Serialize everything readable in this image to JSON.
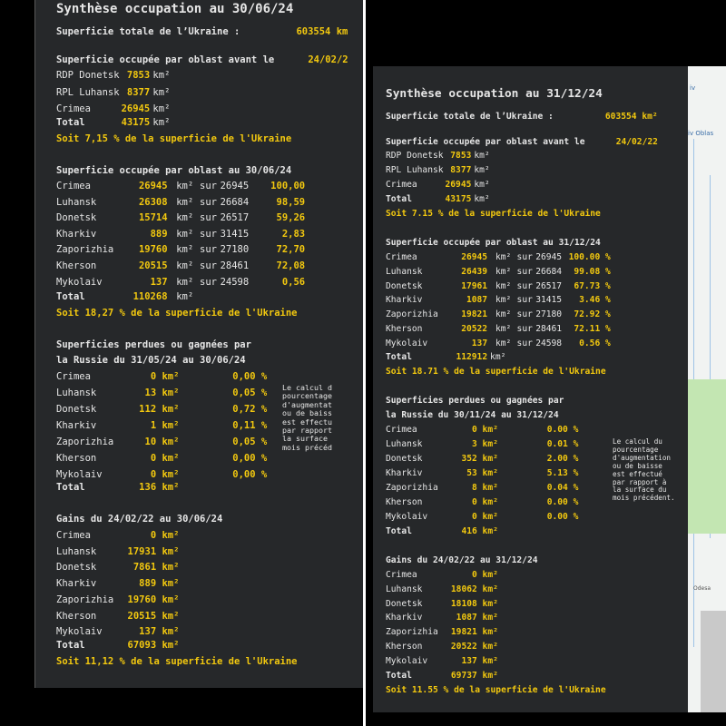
{
  "left": {
    "title": "Synthèse occupation au 30/06/24",
    "total_label": "Superficie totale de l’Ukraine :",
    "total_value": "603554 km",
    "before_head": "Superficie occupée par oblast avant le",
    "before_date": "24/02/2",
    "before_rows": [
      {
        "name": "RDP Donetsk",
        "value": "7853",
        "unit": "km²"
      },
      {
        "name": "RPL Luhansk",
        "value": "8377",
        "unit": "km²"
      },
      {
        "name": "Crimea",
        "value": "26945",
        "unit": "km²"
      }
    ],
    "before_total_label": "Total",
    "before_total_value": "43175",
    "before_total_unit": "km²",
    "before_share": "Soit 7,15 % de la superficie de l'Ukraine",
    "occ_head": "Superficie occupée par oblast au 30/06/24",
    "occ_rows": [
      {
        "name": "Crimea",
        "value": "26945",
        "unit": "km²",
        "sur": "sur",
        "total": "26945",
        "pct": "100,00"
      },
      {
        "name": "Luhansk",
        "value": "26308",
        "unit": "km²",
        "sur": "sur",
        "total": "26684",
        "pct": "98,59"
      },
      {
        "name": "Donetsk",
        "value": "15714",
        "unit": "km²",
        "sur": "sur",
        "total": "26517",
        "pct": "59,26"
      },
      {
        "name": "Kharkiv",
        "value": "889",
        "unit": "km²",
        "sur": "sur",
        "total": "31415",
        "pct": "2,83"
      },
      {
        "name": "Zaporizhia",
        "value": "19760",
        "unit": "km²",
        "sur": "sur",
        "total": "27180",
        "pct": "72,70"
      },
      {
        "name": "Kherson",
        "value": "20515",
        "unit": "km²",
        "sur": "sur",
        "total": "28461",
        "pct": "72,08"
      },
      {
        "name": "Mykolaiv",
        "value": "137",
        "unit": "km²",
        "sur": "sur",
        "total": "24598",
        "pct": "0,56"
      }
    ],
    "occ_total_label": "Total",
    "occ_total_value": "110268",
    "occ_total_unit": "km²",
    "occ_share": "Soit 18,27 % de la superficie de l'Ukraine",
    "change_head1": "Superficies perdues ou gagnées par",
    "change_head2": "la Russie du 31/05/24 au 30/06/24",
    "change_rows": [
      {
        "name": "Crimea",
        "value": "0 km²",
        "pct": "0,00 %"
      },
      {
        "name": "Luhansk",
        "value": "13 km²",
        "pct": "0,05 %"
      },
      {
        "name": "Donetsk",
        "value": "112 km²",
        "pct": "0,72 %"
      },
      {
        "name": "Kharkiv",
        "value": "1 km²",
        "pct": "0,11 %"
      },
      {
        "name": "Zaporizhia",
        "value": "10 km²",
        "pct": "0,05 %"
      },
      {
        "name": "Kherson",
        "value": "0 km²",
        "pct": "0,00 %"
      },
      {
        "name": "Mykolaiv",
        "value": "0 km²",
        "pct": "0,00 %"
      }
    ],
    "change_total_label": "Total",
    "change_total_value": "136 km²",
    "note_lines": [
      "Le calcul d",
      "pourcentage",
      "d'augmentat",
      "ou de baiss",
      "est effectu",
      "par rapport",
      "la surface",
      "mois précéd"
    ],
    "gains_head": "Gains du 24/02/22 au 30/06/24",
    "gains_rows": [
      {
        "name": "Crimea",
        "value": "0 km²"
      },
      {
        "name": "Luhansk",
        "value": "17931 km²"
      },
      {
        "name": "Donetsk",
        "value": "7861 km²"
      },
      {
        "name": "Kharkiv",
        "value": "889 km²"
      },
      {
        "name": "Zaporizhia",
        "value": "19760 km²"
      },
      {
        "name": "Kherson",
        "value": "20515 km²"
      },
      {
        "name": "Mykolaiv",
        "value": "137 km²"
      }
    ],
    "gains_total_label": "Total",
    "gains_total_value": "67093 km²",
    "gains_share": "Soit 11,12 % de la superficie de l'Ukraine"
  },
  "right": {
    "title": "Synthèse occupation au 31/12/24",
    "total_label": "Superficie totale de l’Ukraine :",
    "total_value": "603554 km²",
    "before_head": "Superficie occupée par oblast avant le",
    "before_date": "24/02/22",
    "before_rows": [
      {
        "name": "RDP Donetsk",
        "value": "7853",
        "unit": "km²"
      },
      {
        "name": "RPL Luhansk",
        "value": "8377",
        "unit": "km²"
      },
      {
        "name": "Crimea",
        "value": "26945",
        "unit": "km²"
      }
    ],
    "before_total_label": "Total",
    "before_total_value": "43175",
    "before_total_unit": "km²",
    "before_share": "Soit 7.15 % de la superficie de l'Ukraine",
    "occ_head": "Superficie occupée par oblast au 31/12/24",
    "occ_rows": [
      {
        "name": "Crimea",
        "value": "26945",
        "unit": "km²",
        "sur": "sur",
        "total": "26945",
        "pct": "100.00 %"
      },
      {
        "name": "Luhansk",
        "value": "26439",
        "unit": "km²",
        "sur": "sur",
        "total": "26684",
        "pct": "99.08 %"
      },
      {
        "name": "Donetsk",
        "value": "17961",
        "unit": "km²",
        "sur": "sur",
        "total": "26517",
        "pct": "67.73 %"
      },
      {
        "name": "Kharkiv",
        "value": "1087",
        "unit": "km²",
        "sur": "sur",
        "total": "31415",
        "pct": "3.46 %"
      },
      {
        "name": "Zaporizhia",
        "value": "19821",
        "unit": "km²",
        "sur": "sur",
        "total": "27180",
        "pct": "72.92 %"
      },
      {
        "name": "Kherson",
        "value": "20522",
        "unit": "km²",
        "sur": "sur",
        "total": "28461",
        "pct": "72.11 %"
      },
      {
        "name": "Mykolaiv",
        "value": "137",
        "unit": "km²",
        "sur": "sur",
        "total": "24598",
        "pct": "0.56 %"
      }
    ],
    "occ_total_label": "Total",
    "occ_total_value": "112912",
    "occ_total_unit": "km²",
    "occ_share": "Soit 18.71 % de la superficie de l'Ukraine",
    "change_head1": "Superficies perdues ou gagnées par",
    "change_head2": "la Russie du 30/11/24 au 31/12/24",
    "change_rows": [
      {
        "name": "Crimea",
        "value": "0 km²",
        "pct": "0.00 %"
      },
      {
        "name": "Luhansk",
        "value": "3 km²",
        "pct": "0.01 %"
      },
      {
        "name": "Donetsk",
        "value": "352 km²",
        "pct": "2.00 %"
      },
      {
        "name": "Kharkiv",
        "value": "53 km²",
        "pct": "5.13 %"
      },
      {
        "name": "Zaporizhia",
        "value": "8 km²",
        "pct": "0.04 %"
      },
      {
        "name": "Kherson",
        "value": "0 km²",
        "pct": "0.00 %"
      },
      {
        "name": "Mykolaiv",
        "value": "0 km²",
        "pct": "0.00 %"
      }
    ],
    "change_total_label": "Total",
    "change_total_value": "416 km²",
    "note_lines": [
      "Le calcul du",
      "pourcentage",
      "d'augmentation",
      "ou de baisse",
      "est effectué",
      "par rapport à",
      "la surface du",
      "mois précédent."
    ],
    "gains_head": "Gains du 24/02/22 au 31/12/24",
    "gains_rows": [
      {
        "name": "Crimea",
        "value": "0 km²"
      },
      {
        "name": "Luhansk",
        "value": "18062 km²"
      },
      {
        "name": "Donetsk",
        "value": "18108 km²"
      },
      {
        "name": "Kharkiv",
        "value": "1087 km²"
      },
      {
        "name": "Zaporizhia",
        "value": "19821 km²"
      },
      {
        "name": "Kherson",
        "value": "20522 km²"
      },
      {
        "name": "Mykolaiv",
        "value": "137 km²"
      }
    ],
    "gains_total_label": "Total",
    "gains_total_value": "69737 km²",
    "gains_share": "Soit 11.55 % de la superficie de l'Ukraine"
  },
  "map": {
    "label_top": "iv",
    "label_oblast": "iv Oblas",
    "city_label": "Odesa"
  }
}
